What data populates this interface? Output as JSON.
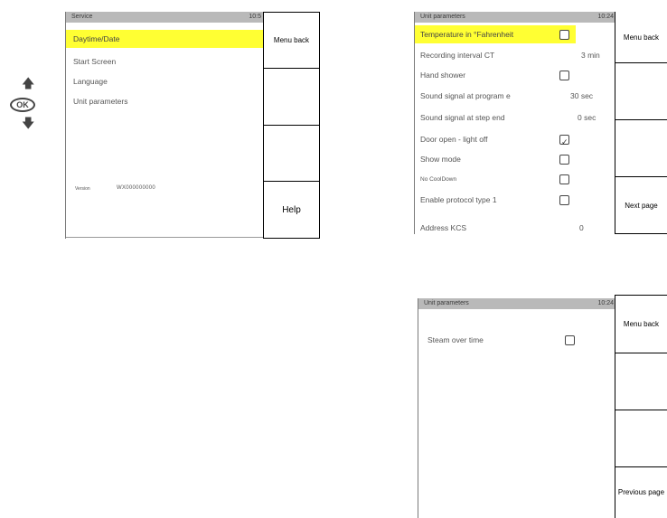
{
  "nav": {
    "up_icon": "arrow-up",
    "ok_label": "OK",
    "down_icon": "arrow-down"
  },
  "panel1": {
    "title": "Service",
    "clock": "10:5",
    "items": [
      {
        "label": "Daytime/Date",
        "selected": true
      },
      {
        "label": "Start Screen",
        "selected": false
      },
      {
        "label": "Language",
        "selected": false
      },
      {
        "label": "Unit parameters",
        "selected": false
      }
    ],
    "version_label": "Version",
    "version_value": "WX000000000",
    "softkeys": [
      "Menu back",
      "",
      "",
      "Help"
    ]
  },
  "panel2": {
    "title": "Unit parameters",
    "clock": "10:24",
    "rows": [
      {
        "label": "Temperature in °Fahrenheit",
        "checkbox": true,
        "checked": false,
        "selected": true
      },
      {
        "label": "Recording interval CT",
        "value": "3 min"
      },
      {
        "label": "Hand shower",
        "checkbox": true,
        "checked": false
      },
      {
        "label": "Sound signal at program e",
        "value": "30 sec"
      },
      {
        "label": "Sound signal at step end",
        "value": "0 sec"
      },
      {
        "label": "Door open - light off",
        "checkbox": true,
        "checked": true
      },
      {
        "label": "Show mode",
        "checkbox": true,
        "checked": false
      },
      {
        "label": "No CoolDown",
        "checkbox": true,
        "checked": false
      },
      {
        "label": "Enable protocol type 1",
        "checkbox": true,
        "checked": false
      },
      {
        "label": "Address KCS",
        "value": "0"
      }
    ],
    "softkeys": [
      "Menu back",
      "",
      "",
      "Next page"
    ]
  },
  "panel3": {
    "title": "Unit parameters",
    "clock": "10:24",
    "rows": [
      {
        "label": "Steam over time",
        "checkbox": true,
        "checked": false
      }
    ],
    "softkeys": [
      "Menu back",
      "",
      "",
      "Previous page"
    ]
  }
}
